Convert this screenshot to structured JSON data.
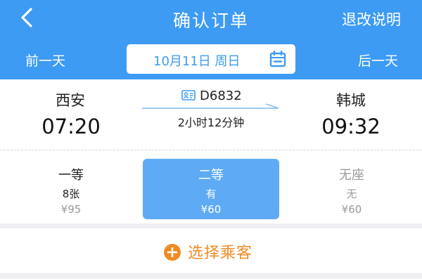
{
  "header": {
    "title": "确认订单",
    "policy_link": "退改说明",
    "prev_day": "前一天",
    "next_day": "后一天",
    "date": "10月11日 周日",
    "background_color": "#3d9bf4"
  },
  "train": {
    "departure_station": "西安",
    "departure_time": "07:20",
    "train_number": "D6832",
    "duration": "2小时12分钟",
    "arrival_station": "韩城",
    "arrival_time": "09:32"
  },
  "seats": [
    {
      "class": "一等",
      "availability": "8张",
      "price": "¥95",
      "selected": false
    },
    {
      "class": "二等",
      "availability": "有",
      "price": "¥60",
      "selected": true
    },
    {
      "class": "无座",
      "availability": "无",
      "price": "¥60",
      "selected": false
    }
  ],
  "passenger": {
    "add_label": "选择乘客",
    "accent_color": "#f08a24"
  },
  "icons": [
    "back-arrow-icon",
    "calendar-icon",
    "id-card-icon",
    "add-circle-icon"
  ]
}
